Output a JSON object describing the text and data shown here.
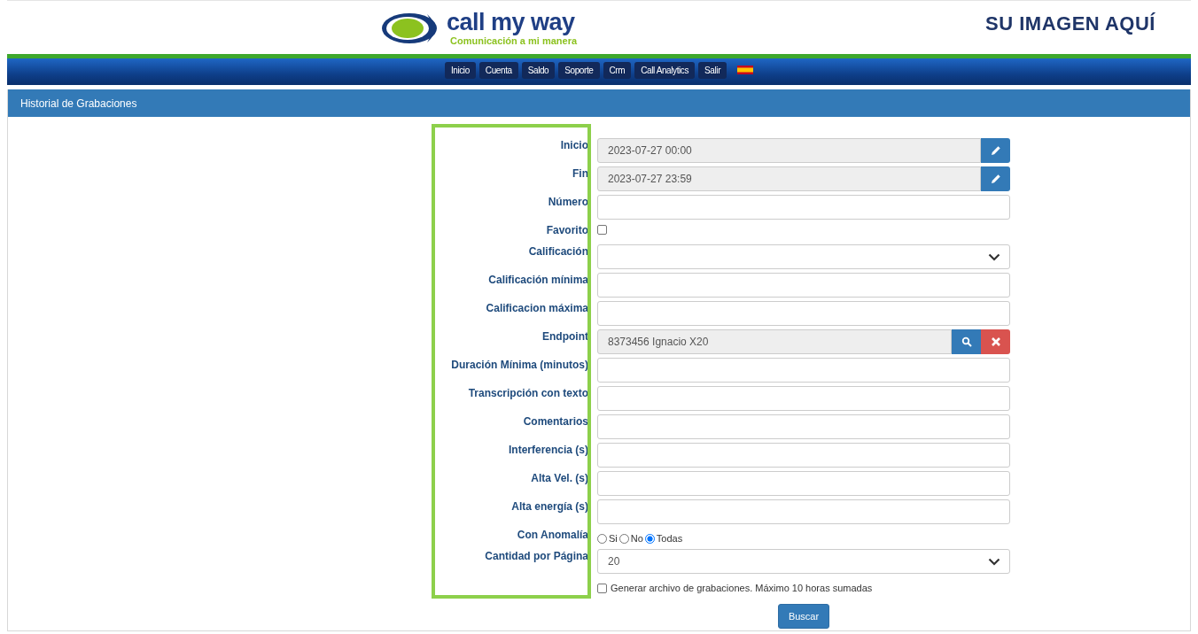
{
  "header": {
    "logo_text": "call my way",
    "tagline": "Comunicación a mi manera",
    "banner_text": "SU IMAGEN AQUÍ"
  },
  "nav": {
    "items": [
      {
        "label": "Inicio"
      },
      {
        "label": "Cuenta"
      },
      {
        "label": "Saldo"
      },
      {
        "label": "Soporte"
      },
      {
        "label": "Crm"
      },
      {
        "label": "Call Analytics"
      },
      {
        "label": "Salir"
      }
    ]
  },
  "panel": {
    "title": "Historial de Grabaciones"
  },
  "form": {
    "fields": [
      {
        "label": "Inicio",
        "kind": "date",
        "value": "2023-07-27 00:00"
      },
      {
        "label": "Fin",
        "kind": "date",
        "value": "2023-07-27 23:59"
      },
      {
        "label": "Número",
        "kind": "text"
      },
      {
        "label": "Favorito",
        "kind": "checkbox",
        "checked": false
      },
      {
        "label": "Calificación",
        "kind": "select"
      },
      {
        "label": "Calificación mínima",
        "kind": "text"
      },
      {
        "label": "Calificacion máxima",
        "kind": "text"
      },
      {
        "label": "Endpoint",
        "kind": "endpoint",
        "value": "8373456 Ignacio X20"
      },
      {
        "label": "Duración Mínima (minutos)",
        "kind": "text"
      },
      {
        "label": "Transcripción con texto",
        "kind": "text"
      },
      {
        "label": "Comentarios",
        "kind": "text"
      },
      {
        "label": "Interferencia (s)",
        "kind": "text"
      },
      {
        "label": "Alta Vel. (s)",
        "kind": "text"
      },
      {
        "label": "Alta energía (s)",
        "kind": "text"
      },
      {
        "label": "Con Anomalía",
        "kind": "radio",
        "options": [
          {
            "label": "Si",
            "selected": false
          },
          {
            "label": "No",
            "selected": false
          },
          {
            "label": "Todas",
            "selected": true
          }
        ]
      },
      {
        "label": "Cantidad por Página",
        "kind": "select",
        "value": "20"
      }
    ],
    "generate": {
      "label": "Generar archivo de grabaciones. Máximo 10 horas sumadas",
      "checked": false
    },
    "submit": "Buscar"
  }
}
